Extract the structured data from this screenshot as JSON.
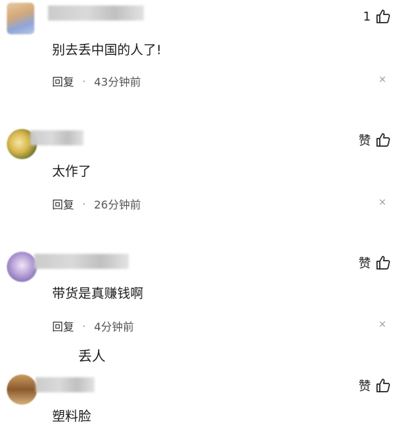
{
  "comments": [
    {
      "text": "别去丢中国的人了!",
      "like_label": "1",
      "reply_label": "回复",
      "separator": "·",
      "time": "43分钟前",
      "close": "×"
    },
    {
      "text": "太作了",
      "like_label": "赞",
      "reply_label": "回复",
      "separator": "·",
      "time": "26分钟前",
      "close": "×"
    },
    {
      "text": "带货是真赚钱啊",
      "like_label": "赞",
      "reply_label": "回复",
      "separator": "·",
      "time": "4分钟前",
      "close": "×",
      "sub_reply": "丢人"
    },
    {
      "text": "塑料脸",
      "like_label": "赞"
    }
  ],
  "icons": {
    "like": "thumbs-up-icon",
    "close": "close-icon"
  }
}
